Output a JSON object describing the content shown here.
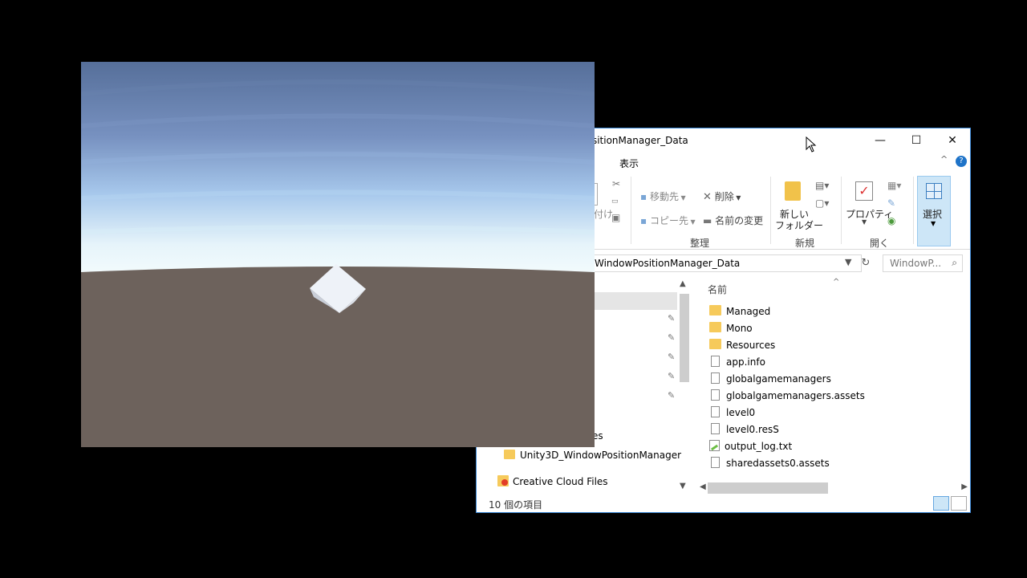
{
  "explorer": {
    "title": "wPositionManager_Data",
    "window_controls": {
      "minimize": "—",
      "maximize": "☐",
      "close": "✕",
      "help": "?",
      "collapse": "^"
    },
    "ribbon_tab_view": "表示",
    "ribbon": {
      "paste_partial": "付け",
      "move_to": "移動先",
      "copy_to": "コピー先",
      "delete": "削除",
      "rename": "名前の変更",
      "group_organize": "整理",
      "new_folder_line1": "新しい",
      "new_folder_line2": "フォルダー",
      "group_new": "新規",
      "properties": "プロパティ",
      "group_open": "開く",
      "select": "選択"
    },
    "address": {
      "path": "WindowPositionManager_Data",
      "search_placeholder": "WindowP..."
    },
    "nav": {
      "partial_item": "es",
      "folder_item": "Unity3D_WindowPositionManager",
      "cloud_item": "Creative Cloud Files"
    },
    "files": {
      "column_name": "名前",
      "items": [
        {
          "name": "Managed",
          "type": "folder"
        },
        {
          "name": "Mono",
          "type": "folder"
        },
        {
          "name": "Resources",
          "type": "folder"
        },
        {
          "name": "app.info",
          "type": "file"
        },
        {
          "name": "globalgamemanagers",
          "type": "file"
        },
        {
          "name": "globalgamemanagers.assets",
          "type": "file"
        },
        {
          "name": "level0",
          "type": "file"
        },
        {
          "name": "level0.resS",
          "type": "file"
        },
        {
          "name": "output_log.txt",
          "type": "text"
        },
        {
          "name": "sharedassets0.assets",
          "type": "file"
        }
      ]
    },
    "status": "10 個の項目",
    "colors": {
      "accent": "#3a87d6",
      "selection": "#cde6f7",
      "folder": "#f6ca5b"
    }
  },
  "game": {
    "colors": {
      "sky_top": "#5b74a0",
      "sky_horizon": "#e8f4f9",
      "ground": "#6d625c",
      "cube": "#eef2f8"
    }
  }
}
